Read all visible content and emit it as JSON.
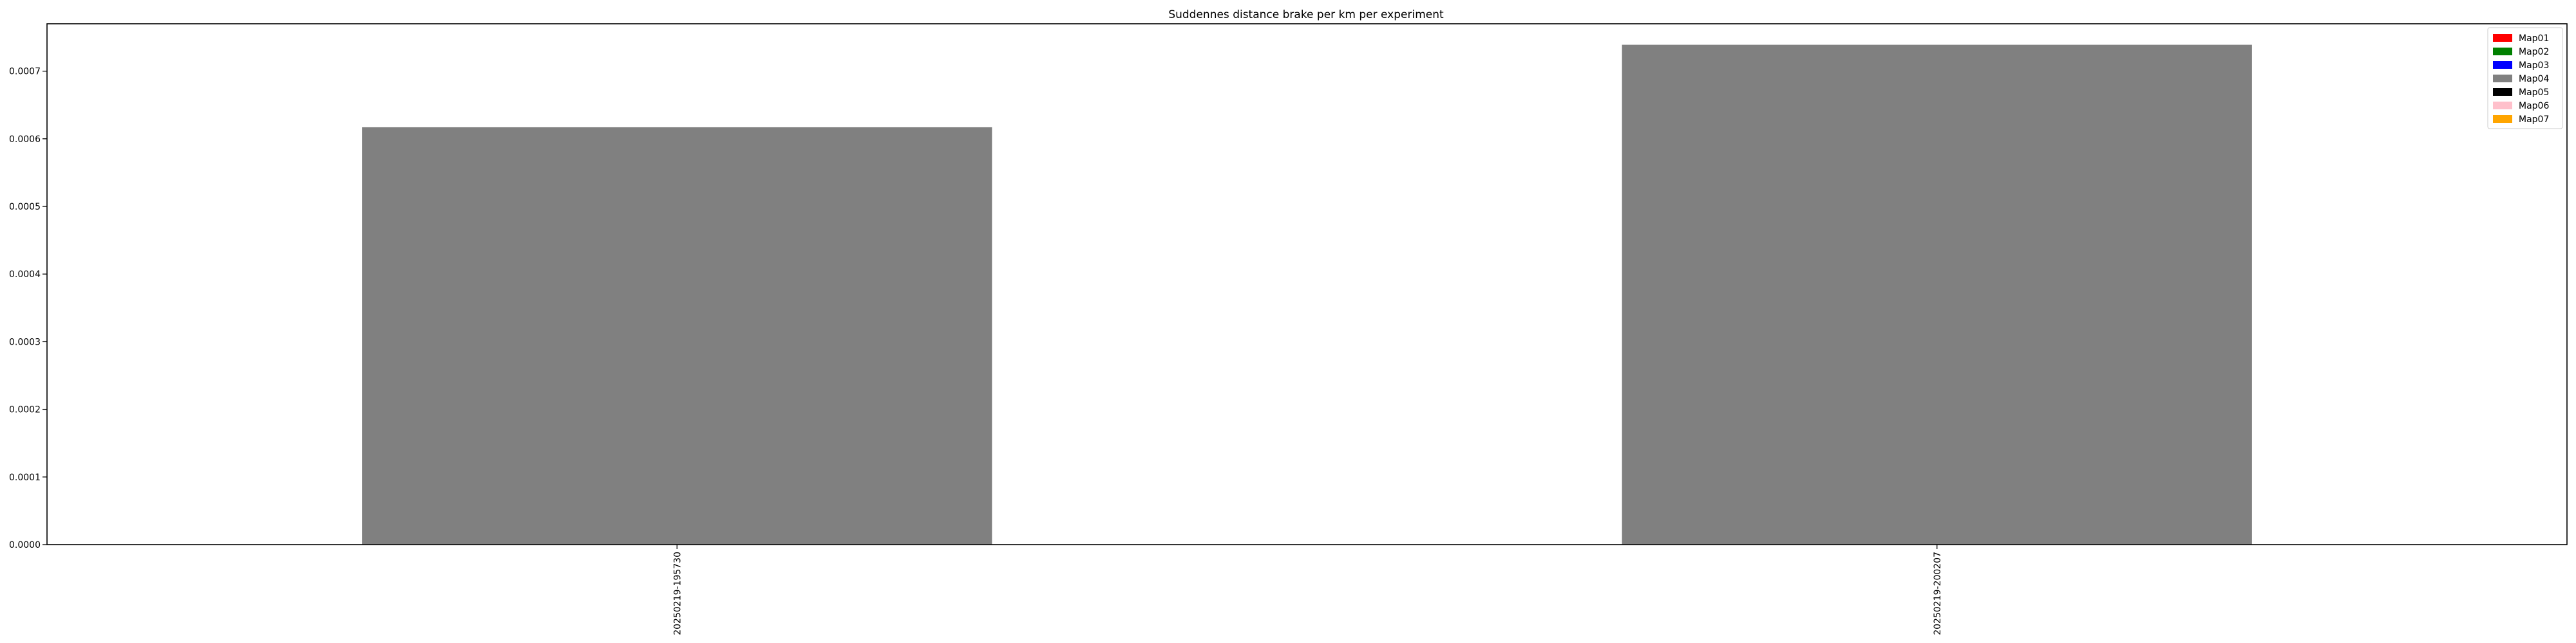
{
  "chart_data": {
    "type": "bar",
    "title": "Suddennes distance brake per km per experiment",
    "xlabel": "",
    "ylabel": "",
    "categories": [
      "20250219-195730",
      "20250219-200207"
    ],
    "series": [
      {
        "name": "Map04",
        "color": "#808080",
        "values": [
          0.000617,
          0.000739
        ]
      }
    ],
    "ylim": [
      0,
      0.00077
    ],
    "yticks": [
      0.0,
      0.0001,
      0.0002,
      0.0003,
      0.0004,
      0.0005,
      0.0006,
      0.0007
    ],
    "ytick_labels": [
      "0.0000",
      "0.0001",
      "0.0002",
      "0.0003",
      "0.0004",
      "0.0005",
      "0.0006",
      "0.0007"
    ],
    "legend": {
      "placement": "top-right",
      "entries": [
        {
          "label": "Map01",
          "color": "#ff0000"
        },
        {
          "label": "Map02",
          "color": "#008000"
        },
        {
          "label": "Map03",
          "color": "#0000ff"
        },
        {
          "label": "Map04",
          "color": "#808080"
        },
        {
          "label": "Map05",
          "color": "#000000"
        },
        {
          "label": "Map06",
          "color": "#ffc0cb"
        },
        {
          "label": "Map07",
          "color": "#ffa500"
        }
      ]
    },
    "grid": false
  }
}
